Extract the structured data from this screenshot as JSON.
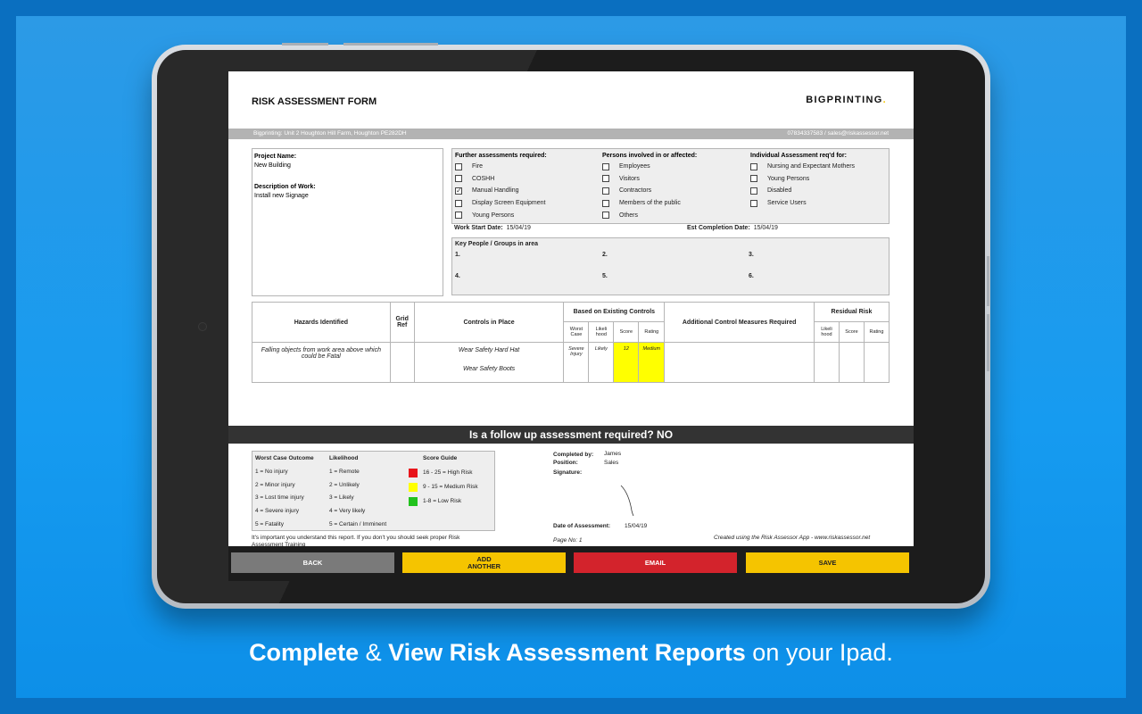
{
  "form": {
    "title": "RISK ASSESSMENT FORM",
    "brand": "BIGPRINTING",
    "brand_dot": ".",
    "address_left": "Bigprinting: Unit 2 Houghton Hill Farm, Houghton    PE282DH",
    "address_right": "07834337583 / sales@riskassessor.net",
    "project_name_label": "Project Name:",
    "project_name": "New Building",
    "description_label": "Description of Work:",
    "description": "Install new Signage",
    "further": {
      "header": "Further assessments required:",
      "items": [
        {
          "label": "Fire",
          "checked": false
        },
        {
          "label": "COSHH",
          "checked": false
        },
        {
          "label": "Manual Handling",
          "checked": true
        },
        {
          "label": "Display Screen Equipment",
          "checked": false
        },
        {
          "label": "Young Persons",
          "checked": false
        }
      ]
    },
    "persons": {
      "header": "Persons involved in or affected:",
      "items": [
        {
          "label": "Employees",
          "checked": false
        },
        {
          "label": "Visitors",
          "checked": false
        },
        {
          "label": "Contractors",
          "checked": false
        },
        {
          "label": "Members of the public",
          "checked": false
        },
        {
          "label": "Others",
          "checked": false
        }
      ]
    },
    "individual": {
      "header": "Individual Assessment req'd for:",
      "items": [
        {
          "label": "Nursing and Expectant Mothers",
          "checked": false
        },
        {
          "label": "Young Persons",
          "checked": false
        },
        {
          "label": "Disabled",
          "checked": false
        },
        {
          "label": "Service Users",
          "checked": false
        }
      ]
    },
    "work_start_label": "Work Start Date:",
    "work_start": "15/04/19",
    "est_completion_label": "Est Completion Date:",
    "est_completion": "15/04/19",
    "key_people_label": "Key People / Groups in area",
    "key_people_numbers": [
      "1.",
      "2.",
      "3.",
      "4.",
      "5.",
      "6."
    ],
    "table": {
      "hazards": "Hazards Identified",
      "grid_ref": "Grid Ref",
      "controls": "Controls in Place",
      "based_on": "Based on Existing Controls",
      "additional": "Additional Control Measures Required",
      "residual": "Residual Risk",
      "worst_case": "Worst Case",
      "likelihood": "Likeli hood",
      "score": "Score",
      "rating": "Rating",
      "row": {
        "hazard": "Falling objects from work area above which could be Fatal",
        "control1": "Wear Safety Hard Hat",
        "control2": "Wear Safety Boots",
        "worst_case": "Severe Injury",
        "likelihood": "Likely",
        "score": "12",
        "rating": "Medium"
      }
    },
    "follow_up": "Is a follow up assessment required? NO",
    "legend": {
      "worst_header": "Worst Case Outcome",
      "likelihood_header": "Likelihood",
      "score_header": "Score Guide",
      "worst": [
        "1 = No injury",
        "2 = Minor injury",
        "3 = Lost time injury",
        "4 = Severe injury",
        "5 = Fatality"
      ],
      "likelihood": [
        "1 = Remote",
        "2 = Unlikely",
        "3 = Likely",
        "4 = Very likely",
        "5 = Certain / Imminent"
      ],
      "score": [
        {
          "label": "16 - 25 = High Risk",
          "color": "#e8141b"
        },
        {
          "label": "9 - 15 = Medium Risk",
          "color": "#ffff00"
        },
        {
          "label": "1-8 = Low Risk",
          "color": "#21c21d"
        }
      ]
    },
    "note": "It's important you understand this report. If you don't you should seek proper Risk Assessment Training",
    "completed_by_label": "Completed by:",
    "completed_by": "James",
    "position_label": "Position:",
    "position": "Sales",
    "signature_label": "Signature:",
    "date_label": "Date of Assessment:",
    "date": "15/04/19",
    "page_no": "Page No: 1",
    "created_using": "Created using the Risk Assessor App - www.riskassessor.net"
  },
  "buttons": {
    "back": "BACK",
    "add_line1": "ADD",
    "add_line2": "ANOTHER",
    "email": "EMAIL",
    "save": "SAVE"
  },
  "colors": {
    "back": "#7a7a7a",
    "add": "#f5c400",
    "email": "#d3232c",
    "save": "#f5c400",
    "background": "#169bf0"
  },
  "caption": {
    "part1": "Complete",
    "amp": " & ",
    "part2": "View Risk Assessment Reports",
    "part3": " on your Ipad."
  }
}
